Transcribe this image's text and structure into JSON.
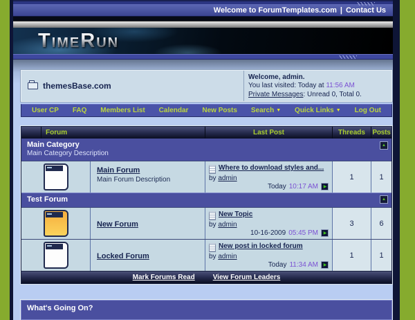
{
  "colors": {
    "frame_green": "#86ab2e",
    "accent_text_green": "#b5d234",
    "category_blue": "#4a4f9f",
    "link_navy": "#16234f",
    "time_purple": "#7b51d3",
    "new_icon_orange": "#f5a93c"
  },
  "top_bar": {
    "welcome_link": "Welcome to ForumTemplates.com",
    "separator": "|",
    "contact_link": "Contact Us"
  },
  "banner": {
    "logo_text": "TimeRun"
  },
  "header_panel": {
    "site_title": "themesBase.com",
    "welcome_box": {
      "greeting": "Welcome, admin.",
      "last_visit_label": "You last visited: Today at",
      "last_visit_time": "11:56 AM",
      "pm_link": "Private Messages",
      "pm_suffix": ": Unread 0, Total 0."
    }
  },
  "navbar": {
    "items": [
      {
        "label": "User CP"
      },
      {
        "label": "FAQ"
      },
      {
        "label": "Members List"
      },
      {
        "label": "Calendar"
      },
      {
        "label": "New Posts"
      },
      {
        "label": "Search",
        "has_dropdown": true
      },
      {
        "label": "Quick Links",
        "has_dropdown": true
      },
      {
        "label": "Log Out"
      }
    ]
  },
  "forum_table": {
    "headers": {
      "forum": "Forum",
      "last_post": "Last Post",
      "threads": "Threads",
      "posts": "Posts"
    },
    "categories": {
      "main": {
        "title": "Main Category",
        "description": "Main Category Description"
      },
      "test": {
        "title": "Test Forum"
      }
    },
    "rows": {
      "main_forum": {
        "title": "Main Forum",
        "description": "Main Forum Description",
        "last_post": {
          "title": "Where to download styles and...",
          "by_label": "by",
          "author": "admin",
          "date": "Today",
          "time": "10:17 AM"
        },
        "threads": "1",
        "posts": "1"
      },
      "new_forum": {
        "title": "New Forum",
        "last_post": {
          "title": "New Topic",
          "by_label": "by",
          "author": "admin",
          "date": "10-16-2009",
          "time": "05:45 PM"
        },
        "threads": "3",
        "posts": "6"
      },
      "locked_forum": {
        "title": "Locked Forum",
        "last_post": {
          "title": "New post in locked forum",
          "by_label": "by",
          "author": "admin",
          "date": "Today",
          "time": "11:34 AM"
        },
        "threads": "1",
        "posts": "1"
      }
    },
    "footer_links": {
      "mark_read": "Mark Forums Read",
      "view_leaders": "View Forum Leaders"
    }
  },
  "whats_going_on": {
    "title": "What's Going On?"
  }
}
